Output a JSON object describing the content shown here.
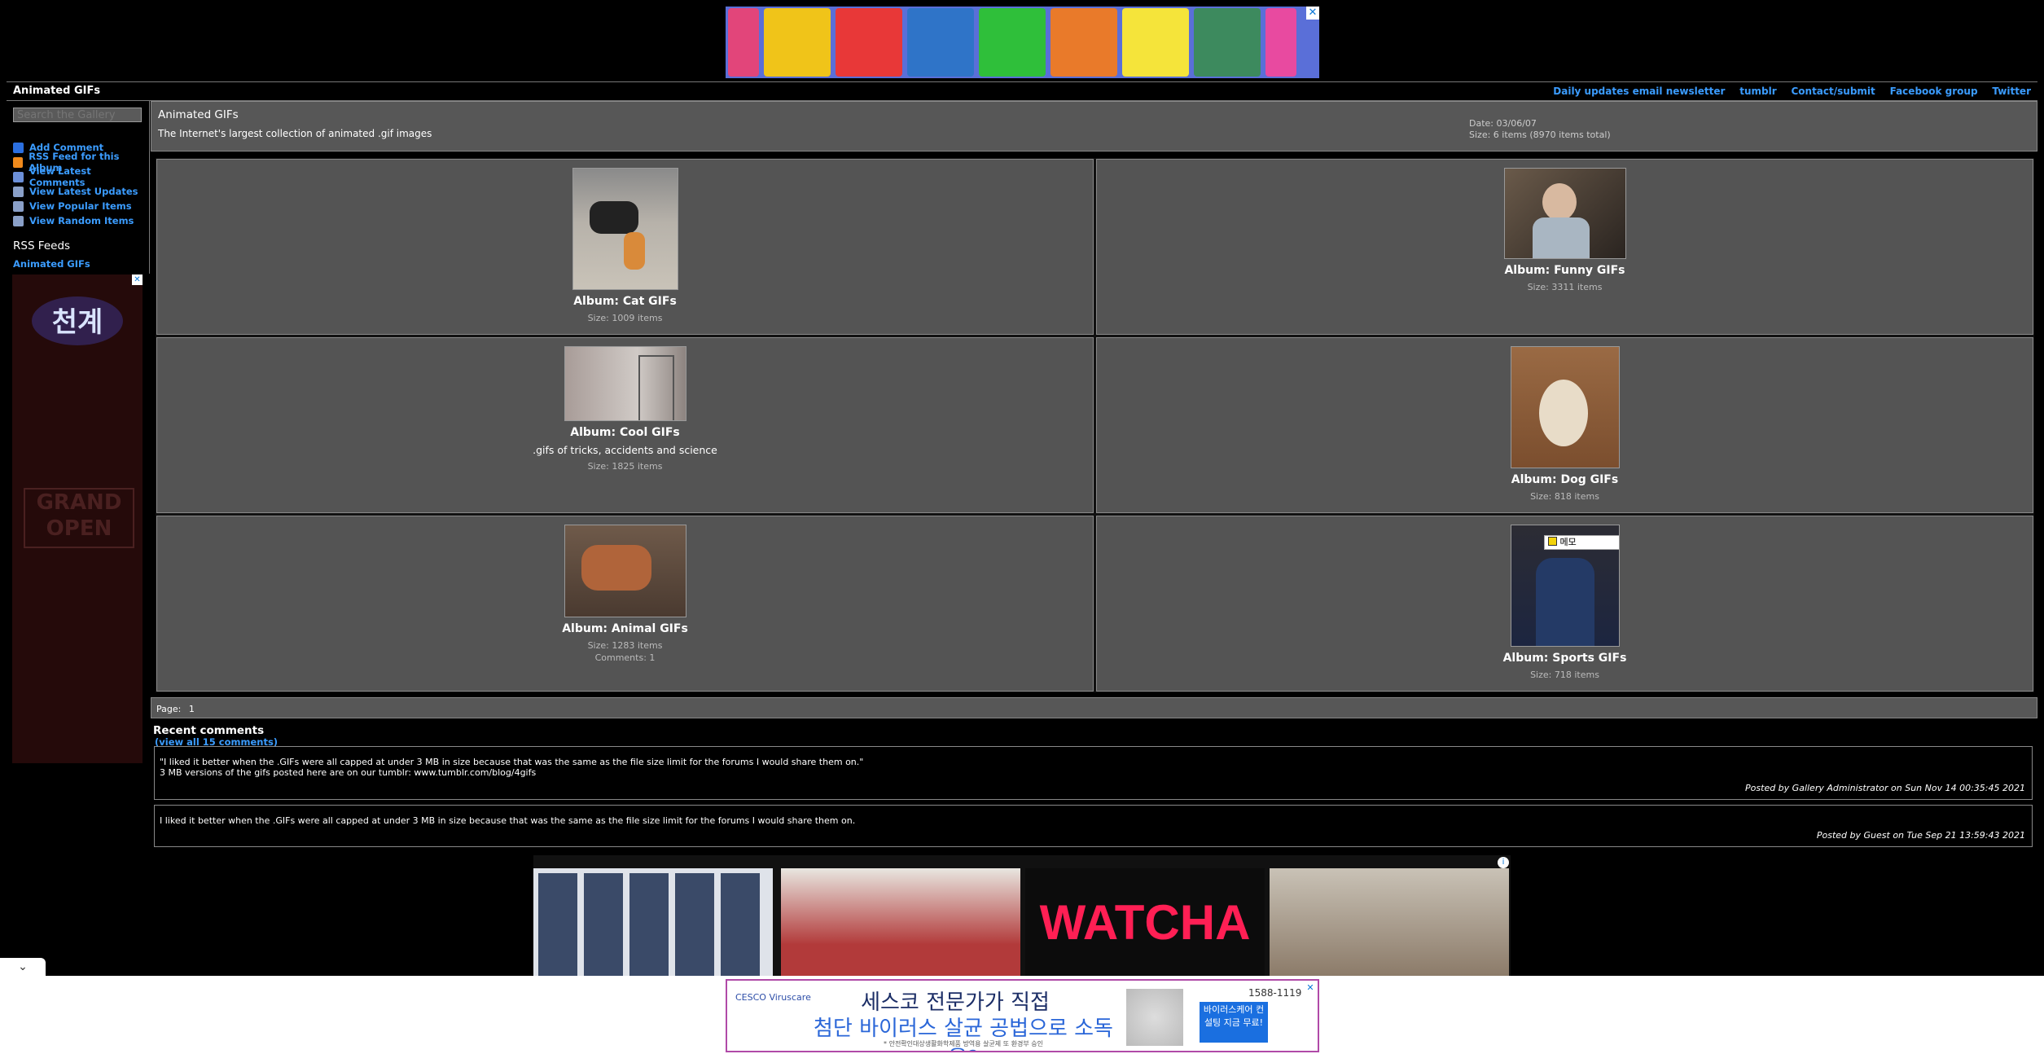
{
  "header": {
    "site_title": "Animated GIFs",
    "links": [
      "Daily updates email newsletter",
      "tumblr",
      "Contact/submit",
      "Facebook group",
      "Twitter"
    ]
  },
  "sidebar": {
    "search_placeholder": "Search the Gallery",
    "links": [
      {
        "label": "Add Comment",
        "icon": "comment-icon"
      },
      {
        "label": "RSS Feed for this Album",
        "icon": "rss-icon"
      },
      {
        "label": "View Latest Comments",
        "icon": "comments-icon"
      },
      {
        "label": "View Latest Updates",
        "icon": "updates-icon"
      },
      {
        "label": "View Popular Items",
        "icon": "popular-icon"
      },
      {
        "label": "View Random Items",
        "icon": "random-icon"
      }
    ],
    "rss_heading": "RSS Feeds",
    "rss_link": "Animated GIFs"
  },
  "album": {
    "title": "Animated GIFs",
    "description": "The Internet's largest collection of animated .gif images",
    "date": "Date: 03/06/07",
    "size": "Size: 6 items (8970 items total)"
  },
  "albums": [
    {
      "name": "Album: Cat GIFs",
      "subtitle": "",
      "size": "Size: 1009 items",
      "comments": ""
    },
    {
      "name": "Album: Funny GIFs",
      "subtitle": "",
      "size": "Size: 3311 items",
      "comments": ""
    },
    {
      "name": "Album: Cool GIFs",
      "subtitle": ".gifs of tricks, accidents and science",
      "size": "Size: 1825 items",
      "comments": ""
    },
    {
      "name": "Album: Dog GIFs",
      "subtitle": "",
      "size": "Size: 818 items",
      "comments": ""
    },
    {
      "name": "Album: Animal GIFs",
      "subtitle": "",
      "size": "Size: 1283 items",
      "comments": "Comments: 1"
    },
    {
      "name": "Album: Sports GIFs",
      "subtitle": "",
      "size": "Size: 718 items",
      "comments": ""
    }
  ],
  "pager": {
    "label": "Page:",
    "page": "1"
  },
  "recent": {
    "title": "Recent comments",
    "view_all": "(view all 15 comments)",
    "comments": [
      {
        "line1": "\"I liked it better when the .GIFs were all capped at under 3 MB in size because that was the same as the file size limit for the forums I would share them on.\"",
        "line2": "3 MB versions of the gifs posted here are on our tumblr: www.tumblr.com/blog/4gifs",
        "by": "Posted by Gallery Administrator on Sun Nov 14 00:35:45 2021"
      },
      {
        "line1": "I liked it better when the .GIFs were all capped at under 3 MB in size because that was the same as the file size limit for the forums I would share them on.",
        "line2": "",
        "by": "Posted by Guest on Tue Sep 21 13:59:43 2021"
      }
    ]
  },
  "sports_popup_label": "메모",
  "side_ad": {
    "logo_text": "천계",
    "banner_text": "GRAND OPEN"
  },
  "mid_ad": {
    "brand": "WATCHA"
  },
  "bottom_ad": {
    "brand": "CESCO Viruscare",
    "headline1": "세스코 전문가가 직접",
    "headline2": "첨단 바이러스 살균 공법으로 소독을?",
    "phone": "1588-1119",
    "cta": "바이러스케어 컨설팅 지금 무료!",
    "fine_print": "* 안전확인대상생활화학제품 방역용 살균제 또 환경부 승인"
  },
  "colors": {
    "link": "#3b9cff",
    "panel": "#575757",
    "background": "#000000"
  }
}
